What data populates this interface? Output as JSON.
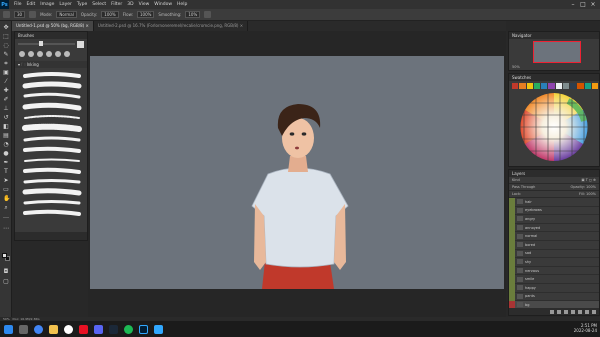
{
  "menubar": {
    "items": [
      "File",
      "Edit",
      "Image",
      "Layer",
      "Type",
      "Select",
      "Filter",
      "3D",
      "View",
      "Window",
      "Help"
    ]
  },
  "optbar": {
    "brush_size": "30",
    "mode_label": "Mode:",
    "mode_value": "Normal",
    "opacity_label": "Opacity:",
    "opacity_value": "100%",
    "flow_label": "Flow:",
    "flow_value": "100%",
    "smoothing_label": "Smoothing:",
    "smoothing_value": "10%"
  },
  "tabs": [
    {
      "label": "Untitled-1.psd @ 50% (bg, RGB/8) ×",
      "active": true
    },
    {
      "label": "Untitled-2.psd @ 16.7% (Forlornoneremel/recalie/cromcie.png, RGB/8) ×",
      "active": false
    }
  ],
  "brushes_panel": {
    "title": "Brushes",
    "size_value": "30",
    "folder_label": "Inking"
  },
  "navigator": {
    "title": "Navigator",
    "zoom": "50%"
  },
  "swatches": {
    "title": "Swatches",
    "colors": [
      "#c0392b",
      "#e67e22",
      "#f1c40f",
      "#27ae60",
      "#2980b9",
      "#8e44ad",
      "#ecf0f1",
      "#7f8c8d",
      "#2c3e50",
      "#d35400",
      "#16a085",
      "#f39c12"
    ]
  },
  "layers": {
    "title": "Layers",
    "kind_label": "Kind",
    "blend_mode": "Pass Through",
    "opacity_label": "Opacity:",
    "opacity_value": "100%",
    "lock_label": "Lock:",
    "fill_label": "Fill:",
    "fill_value": "100%",
    "items": [
      {
        "name": "hair",
        "visible": true
      },
      {
        "name": "eyebrows",
        "visible": true
      },
      {
        "name": "angry",
        "visible": true
      },
      {
        "name": "annoyed",
        "visible": true
      },
      {
        "name": "normal",
        "visible": true
      },
      {
        "name": "bored",
        "visible": true
      },
      {
        "name": "sad",
        "visible": true
      },
      {
        "name": "shy",
        "visible": true
      },
      {
        "name": "nervous",
        "visible": true
      },
      {
        "name": "smile",
        "visible": true
      },
      {
        "name": "happy",
        "visible": true
      },
      {
        "name": "pants",
        "visible": true
      },
      {
        "name": "bg",
        "visible": true,
        "selected": true
      }
    ]
  },
  "status": {
    "zoom": "50%",
    "doc": "Doc: 16.9M/2.36G"
  },
  "taskbar": {
    "time": "2:51 PM",
    "date": "2022-08-24"
  }
}
